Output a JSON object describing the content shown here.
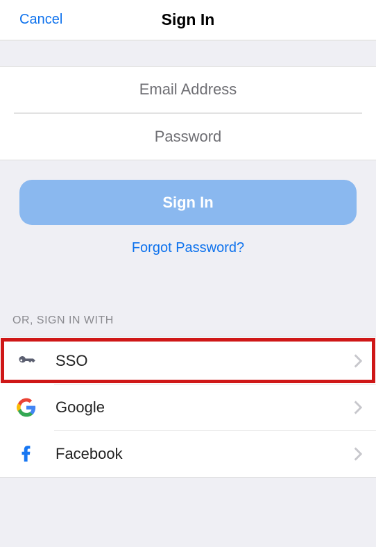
{
  "header": {
    "cancel": "Cancel",
    "title": "Sign In"
  },
  "form": {
    "email_placeholder": "Email Address",
    "password_placeholder": "Password",
    "email_value": "",
    "password_value": ""
  },
  "actions": {
    "signin_label": "Sign In",
    "forgot_label": "Forgot Password?"
  },
  "divider": {
    "label": "OR, SIGN IN WITH"
  },
  "providers": [
    {
      "id": "sso",
      "label": "SSO",
      "icon": "key-icon",
      "highlighted": true
    },
    {
      "id": "google",
      "label": "Google",
      "icon": "google-icon",
      "highlighted": false
    },
    {
      "id": "facebook",
      "label": "Facebook",
      "icon": "facebook-icon",
      "highlighted": false
    }
  ],
  "colors": {
    "link": "#0e72ed",
    "primary_button": "#8ab8ef",
    "highlight": "#cf1717"
  }
}
